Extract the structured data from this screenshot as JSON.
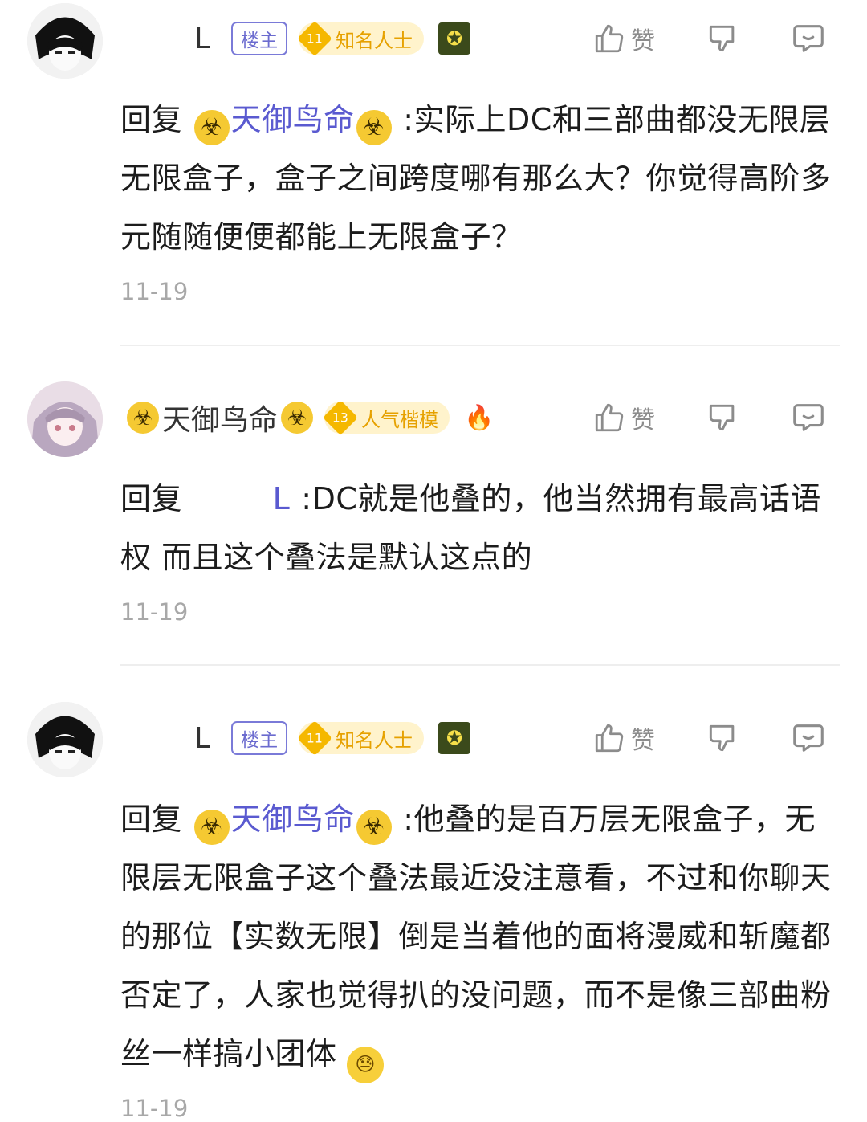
{
  "comments": [
    {
      "author": "L",
      "host_badge": "楼主",
      "level": "11",
      "level_title": "知名人士",
      "actions": {
        "like_label": "赞"
      },
      "reply_prefix": "回复",
      "reply_target": "天御鸟命",
      "text": ":实际上DC和三部曲都没无限层无限盒子，盒子之间跨度哪有那么大？你觉得高阶多元随随便便都能上无限盒子？",
      "time": "11-19"
    },
    {
      "author": "天御鸟命",
      "level": "13",
      "level_title": "人气楷模",
      "actions": {
        "like_label": "赞"
      },
      "reply_prefix": "回复",
      "reply_target": "L",
      "text": ":DC就是他叠的，他当然拥有最高话语权 而且这个叠法是默认这点的",
      "time": "11-19"
    },
    {
      "author": "L",
      "host_badge": "楼主",
      "level": "11",
      "level_title": "知名人士",
      "actions": {
        "like_label": "赞"
      },
      "reply_prefix": "回复",
      "reply_target": "天御鸟命",
      "text": ":他叠的是百万层无限盒子，无限层无限盒子这个叠法最近没注意看，不过和你聊天的那位【实数无限】倒是当着他的面将漫威和斩魔都否定了，人家也觉得扒的没问题，而不是像三部曲粉丝一样搞小团体",
      "time": "11-19"
    }
  ],
  "icons": {
    "biohazard": "☣",
    "medal": "✪",
    "fire": "🔥",
    "sweat_emoji": "😓"
  },
  "colors": {
    "reply_target": "#5a5ad0",
    "level_badge": "#f5b800",
    "host_badge": "#7a7ad8",
    "timestamp": "#a8a8a8"
  }
}
